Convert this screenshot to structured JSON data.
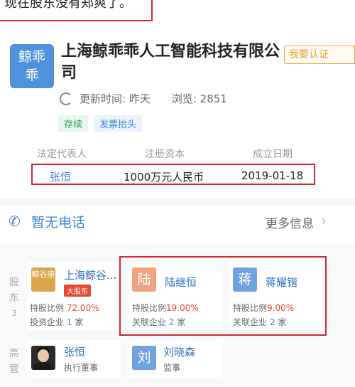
{
  "caption": "现在股东没有郑爽了。",
  "company": {
    "logo_text": "鲸乖乖",
    "name": "上海鲸乖乖人工智能科技有限公司",
    "claim_label": "我要认证",
    "updated_label": "更新时间: 昨天",
    "views_label": "浏览: 2851",
    "tags": [
      "存续",
      "发票抬头"
    ]
  },
  "info": {
    "headers": [
      "法定代表人",
      "注册资本",
      "成立日期"
    ],
    "values": [
      "张恒",
      "1000万元人民币",
      "2019-01-18"
    ]
  },
  "contact": {
    "phone_label": "暂无电话",
    "more_label": "更多信息"
  },
  "shareholders": {
    "side_label": [
      "股",
      "东",
      "3"
    ],
    "items": [
      {
        "avatar": "鲸谷座",
        "name": "上海鲸谷...",
        "badge": "大股东",
        "ratio_label": "持股比例",
        "ratio": "72.00%",
        "rel_label": "投资企业",
        "rel_count": "1",
        "rel_unit": "家",
        "color": "#d9a64a"
      },
      {
        "avatar": "陆",
        "name": "陆继恒",
        "ratio_label": "持股比例",
        "ratio": "19.00%",
        "rel_label": "关联企业",
        "rel_count": "2",
        "rel_unit": "家",
        "color": "#f0a37f"
      },
      {
        "avatar": "蒋",
        "name": "蒋耀锴",
        "ratio_label": "持股比例",
        "ratio": "9.00%",
        "rel_label": "关联企业",
        "rel_count": "2",
        "rel_unit": "家",
        "color": "#6fa2de"
      }
    ]
  },
  "executives": {
    "side_label": [
      "高",
      "管"
    ],
    "items": [
      {
        "name": "张恒",
        "role": "执行董事"
      },
      {
        "avatar": "刘",
        "name": "刘晓森",
        "role": "监事",
        "color": "#6fa2de"
      }
    ]
  }
}
